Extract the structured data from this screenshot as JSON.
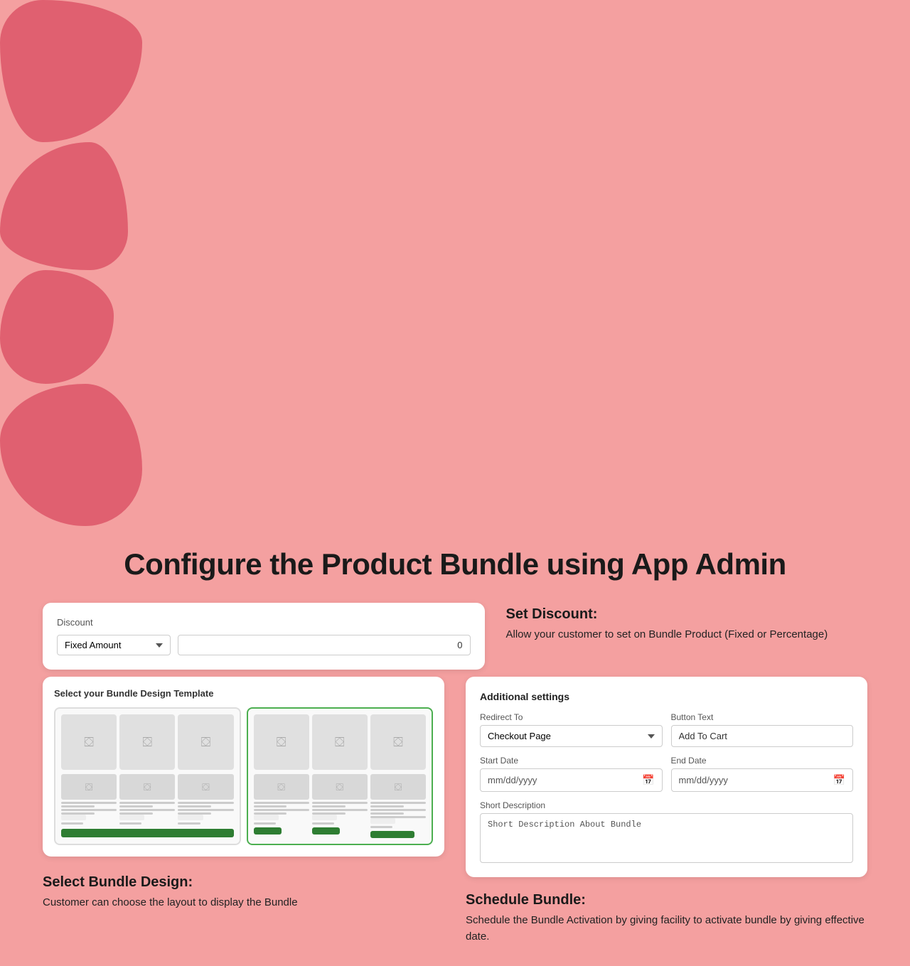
{
  "page": {
    "title": "Configure the Product Bundle using App Admin"
  },
  "discount_section": {
    "card_label": "Discount",
    "select_label": "Fixed Amount",
    "input_value": "0",
    "section_title": "Set Discount:",
    "section_text": "Allow your customer to set on Bundle Product (Fixed or Percentage)"
  },
  "bundle_design_section": {
    "card_title": "Select your Bundle Design Template",
    "section_title": "Select Bundle Design:",
    "section_text": "Customer can choose the layout to display the Bundle",
    "template1": {
      "items": [
        "🖼",
        "🖼",
        "🖼"
      ]
    },
    "template2": {
      "items": [
        "🖼",
        "🖼",
        "🖼"
      ],
      "selected": true
    }
  },
  "additional_settings": {
    "card_title": "Additional settings",
    "redirect_to_label": "Redirect To",
    "redirect_to_value": "Checkout Page",
    "button_text_label": "Button Text",
    "button_text_value": "Add To Cart",
    "start_date_label": "Start Date",
    "start_date_placeholder": "mm/dd/yyyy",
    "end_date_label": "End Date",
    "end_date_placeholder": "mm/dd/yyyy",
    "short_desc_label": "Short Description",
    "short_desc_value": "Short Description About Bundle"
  },
  "schedule_section": {
    "section_title": "Schedule Bundle:",
    "section_text": "Schedule the Bundle Activation by giving facility to activate bundle by giving effective date."
  }
}
